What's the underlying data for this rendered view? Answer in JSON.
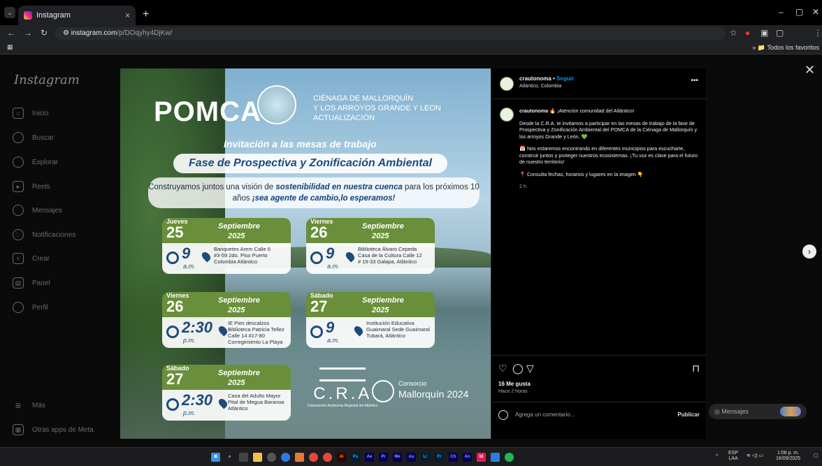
{
  "browser": {
    "tab_title": "Instagram",
    "tab_close": "×",
    "new_tab": "+",
    "url_host": "instagram.com",
    "url_path": "/p/DOqyhy4DjKw/",
    "all_bookmarks": "Todos los favoritos",
    "min": "–",
    "max": "▢",
    "close": "✕"
  },
  "sidebar": {
    "logo": "Instagram",
    "items": [
      {
        "label": "Inicio",
        "icon": "⌂"
      },
      {
        "label": "Buscar",
        "icon": "⌕"
      },
      {
        "label": "Explorar",
        "icon": "◎"
      },
      {
        "label": "Reels",
        "icon": "▶"
      },
      {
        "label": "Mensajes",
        "icon": "✉"
      },
      {
        "label": "Notificaciones",
        "icon": "♡"
      },
      {
        "label": "Crear",
        "icon": "+"
      },
      {
        "label": "Panel",
        "icon": "▤"
      },
      {
        "label": "Perfil",
        "icon": "●"
      }
    ],
    "more": "Más",
    "meta": "Otras apps de Meta"
  },
  "post_image": {
    "brand": "POMCA",
    "subtitle": "CIÉNAGA DE MALLORQUÍN\nY LOS ARROYOS GRANDE Y LEON\nACTUALIZACIÓN",
    "invitation": "Invitación a las mesas de trabajo",
    "phase": "Fase de Prospectiva y Zonificación Ambiental",
    "tagline_1": "Construyamos juntos una visión de ",
    "tagline_bold": "sostenibilidad en nuestra cuenca",
    "tagline_2": " para los próximos 10 años ",
    "tagline_bold2": "¡sea agente de cambio,lo esperamos!",
    "events": [
      {
        "dayname": "Jueves",
        "day": "25",
        "month": "Septiembre",
        "year": "2025",
        "time": "9",
        "ampm": "a.m.",
        "place": "Banquetes Arem Calle 6 #3-59 2do. Piso Puerto Colombia Atlántico"
      },
      {
        "dayname": "Viernes",
        "day": "26",
        "month": "Septiembre",
        "year": "2025",
        "time": "9",
        "ampm": "a.m.",
        "place": "Biblioteca Álvaro Cepeda Casa de la Cultura Calle 12 # 19-33 Galapa, Atlántico"
      },
      {
        "dayname": "Viernes",
        "day": "26",
        "month": "Septiembre",
        "year": "2025",
        "time": "2:30",
        "ampm": "p.m.",
        "place": "IE Pies descalzos Biblioteca Patricia Tellez Calle 14 #17-80 Corregimiento La Playa"
      },
      {
        "dayname": "Sábado",
        "day": "27",
        "month": "Septiembre",
        "year": "2025",
        "time": "9",
        "ampm": "a.m.",
        "place": "Institución Educativa Guaimaral Sede Guaimaral Tubará, Atlántico"
      },
      {
        "dayname": "Sábado",
        "day": "27",
        "month": "Septiembre",
        "year": "2025",
        "time": "2:30",
        "ampm": "p.m.",
        "place": "Casa del Adulto Mayor Pital de Megua Baranoa Atlántico"
      }
    ],
    "cra": "C.R.A",
    "cra_small": "Corporación Autónoma Regional del Atlántico",
    "consorcio_1": "Consorcio",
    "consorcio_2": "Mallorquín 2024"
  },
  "panel": {
    "username": "crautonoma",
    "follow": "Seguir",
    "location": "Atlántico, Colombia",
    "caption_user": "crautonoma",
    "caption_intro": "🔥 ¡Atención comunidad del Atlántico!",
    "caption_p1": "Desde la C.R.A. te invitamos a participar en las mesas de trabajo de la fase de Prospectiva y Zonificación Ambiental del POMCA de la Ciénaga de Mallorquín y los arroyos Grande y León. 💚",
    "caption_p2": "📅 Nos estaremos encontrando en diferentes municipios para escucharte, construir juntos y proteger nuestros ecosistemas. ¡Tu voz es clave para el futuro de nuestro territorio!",
    "caption_p3": "📍 Consulta fechas, horarios y lugares en la imagen 👇",
    "caption_time": "2 h",
    "likes": "16 Me gusta",
    "posted": "Hace 2 horas",
    "comment_placeholder": "Agrega un comentario...",
    "publish": "Publicar"
  },
  "messages_pill": "Mensajes",
  "taskbar": {
    "lang": "ESP\nLAA",
    "clock": "1:08 p. m.\n16/09/2025"
  }
}
